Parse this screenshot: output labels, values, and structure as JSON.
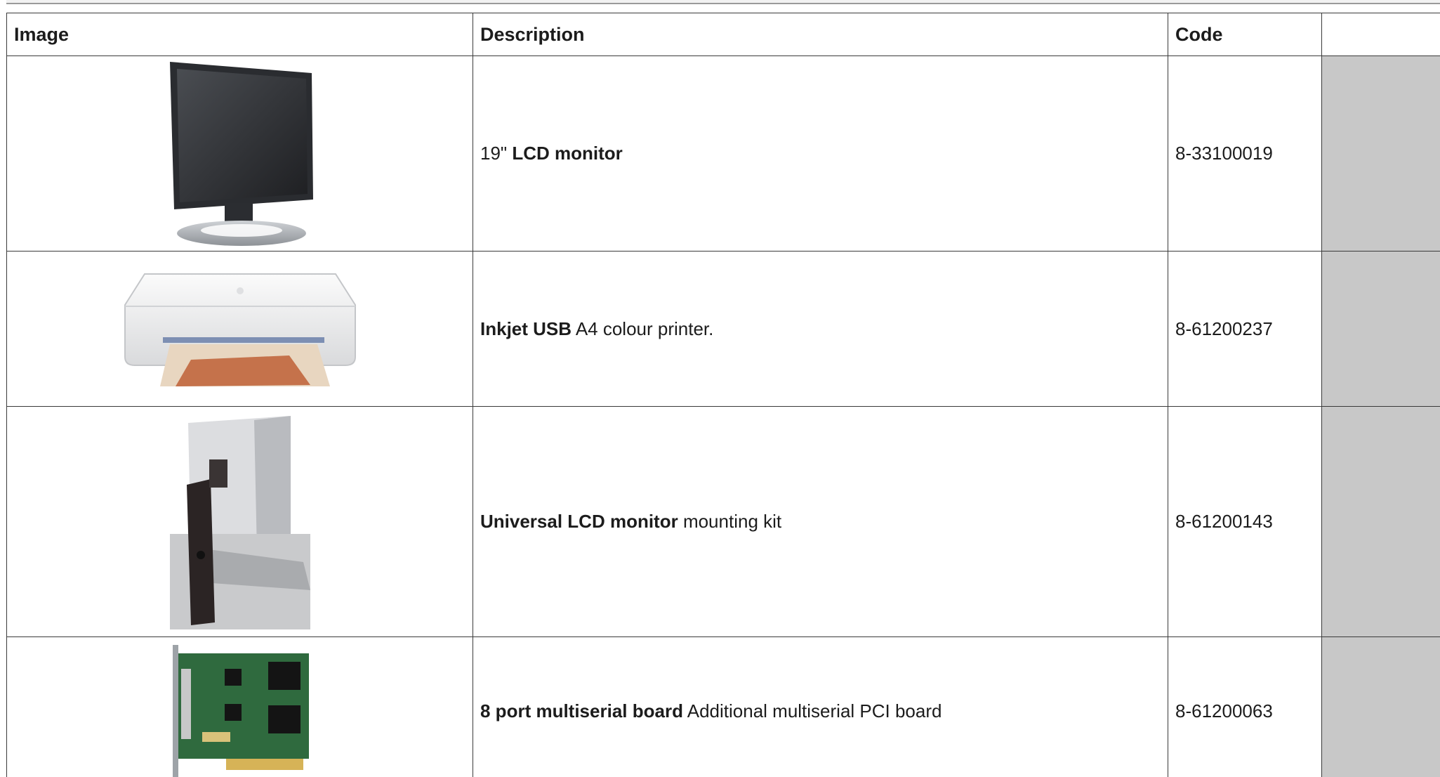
{
  "table": {
    "headers": {
      "image": "Image",
      "description": "Description",
      "code": "Code",
      "extra": ""
    },
    "rows": [
      {
        "image_icon": "lcd-monitor-photo",
        "desc_pre": "19\" ",
        "desc_bold": "LCD monitor",
        "desc_post": "",
        "code": "8-33100019"
      },
      {
        "image_icon": "inkjet-printer-photo",
        "desc_pre": "",
        "desc_bold": "Inkjet USB",
        "desc_post": " A4 colour printer.",
        "code": "8-61200237"
      },
      {
        "image_icon": "monitor-mounting-kit-photo",
        "desc_pre": "",
        "desc_bold": "Universal LCD monitor",
        "desc_post": " mounting kit",
        "code": "8-61200143"
      },
      {
        "image_icon": "multiserial-board-photo",
        "desc_pre": "",
        "desc_bold": "8 port multiserial board",
        "desc_post": " Additional multiserial PCI board",
        "code": "8-61200063"
      }
    ]
  },
  "colors": {
    "extra_column_fill": "#c8c8c8",
    "border": "#3a3a3a"
  }
}
